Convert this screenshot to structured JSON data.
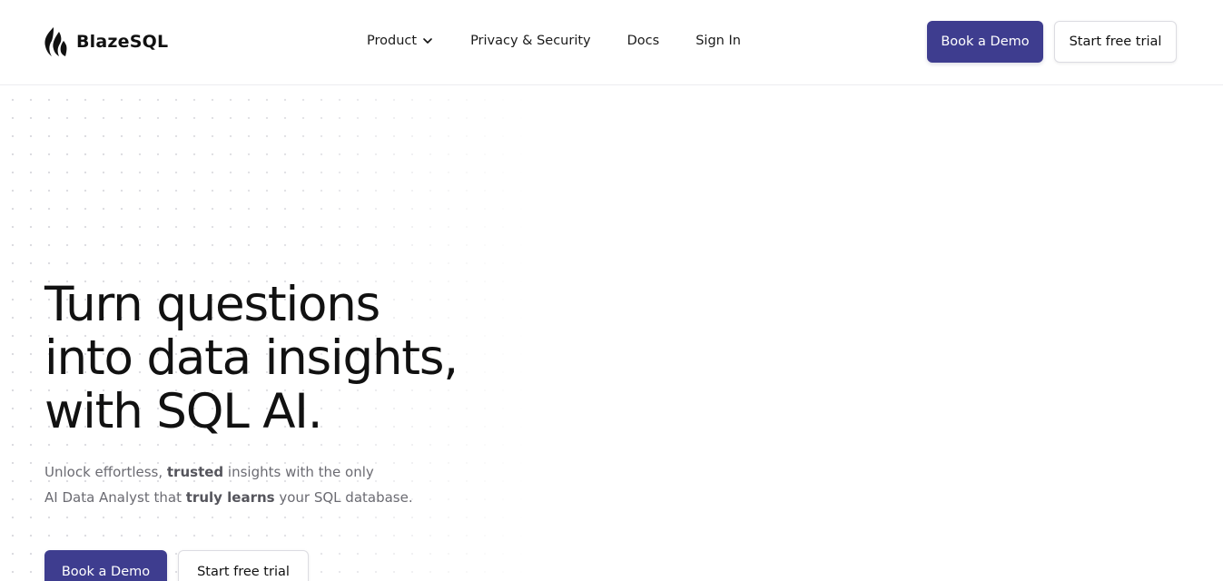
{
  "brand": {
    "name": "BlazeSQL",
    "logo_icon": "flame-icon"
  },
  "nav": {
    "product": "Product",
    "privacy": "Privacy & Security",
    "docs": "Docs",
    "signin": "Sign In"
  },
  "header_actions": {
    "demo": "Book a Demo",
    "trial": "Start free trial"
  },
  "hero": {
    "title_line1": "Turn questions",
    "title_line2": "into data insights,",
    "title_line3": "with SQL AI.",
    "sub_part1": "Unlock effortless, ",
    "sub_bold1": "trusted",
    "sub_part2": " insights with the only",
    "sub_part3": "AI Data Analyst that ",
    "sub_bold2": "truly learns",
    "sub_part4": " your SQL database.",
    "demo_button": "Book a Demo",
    "trial_button": "Start free trial"
  },
  "colors": {
    "primary": "#3e3d8f",
    "text": "#111111",
    "muted": "#6b6b72"
  }
}
